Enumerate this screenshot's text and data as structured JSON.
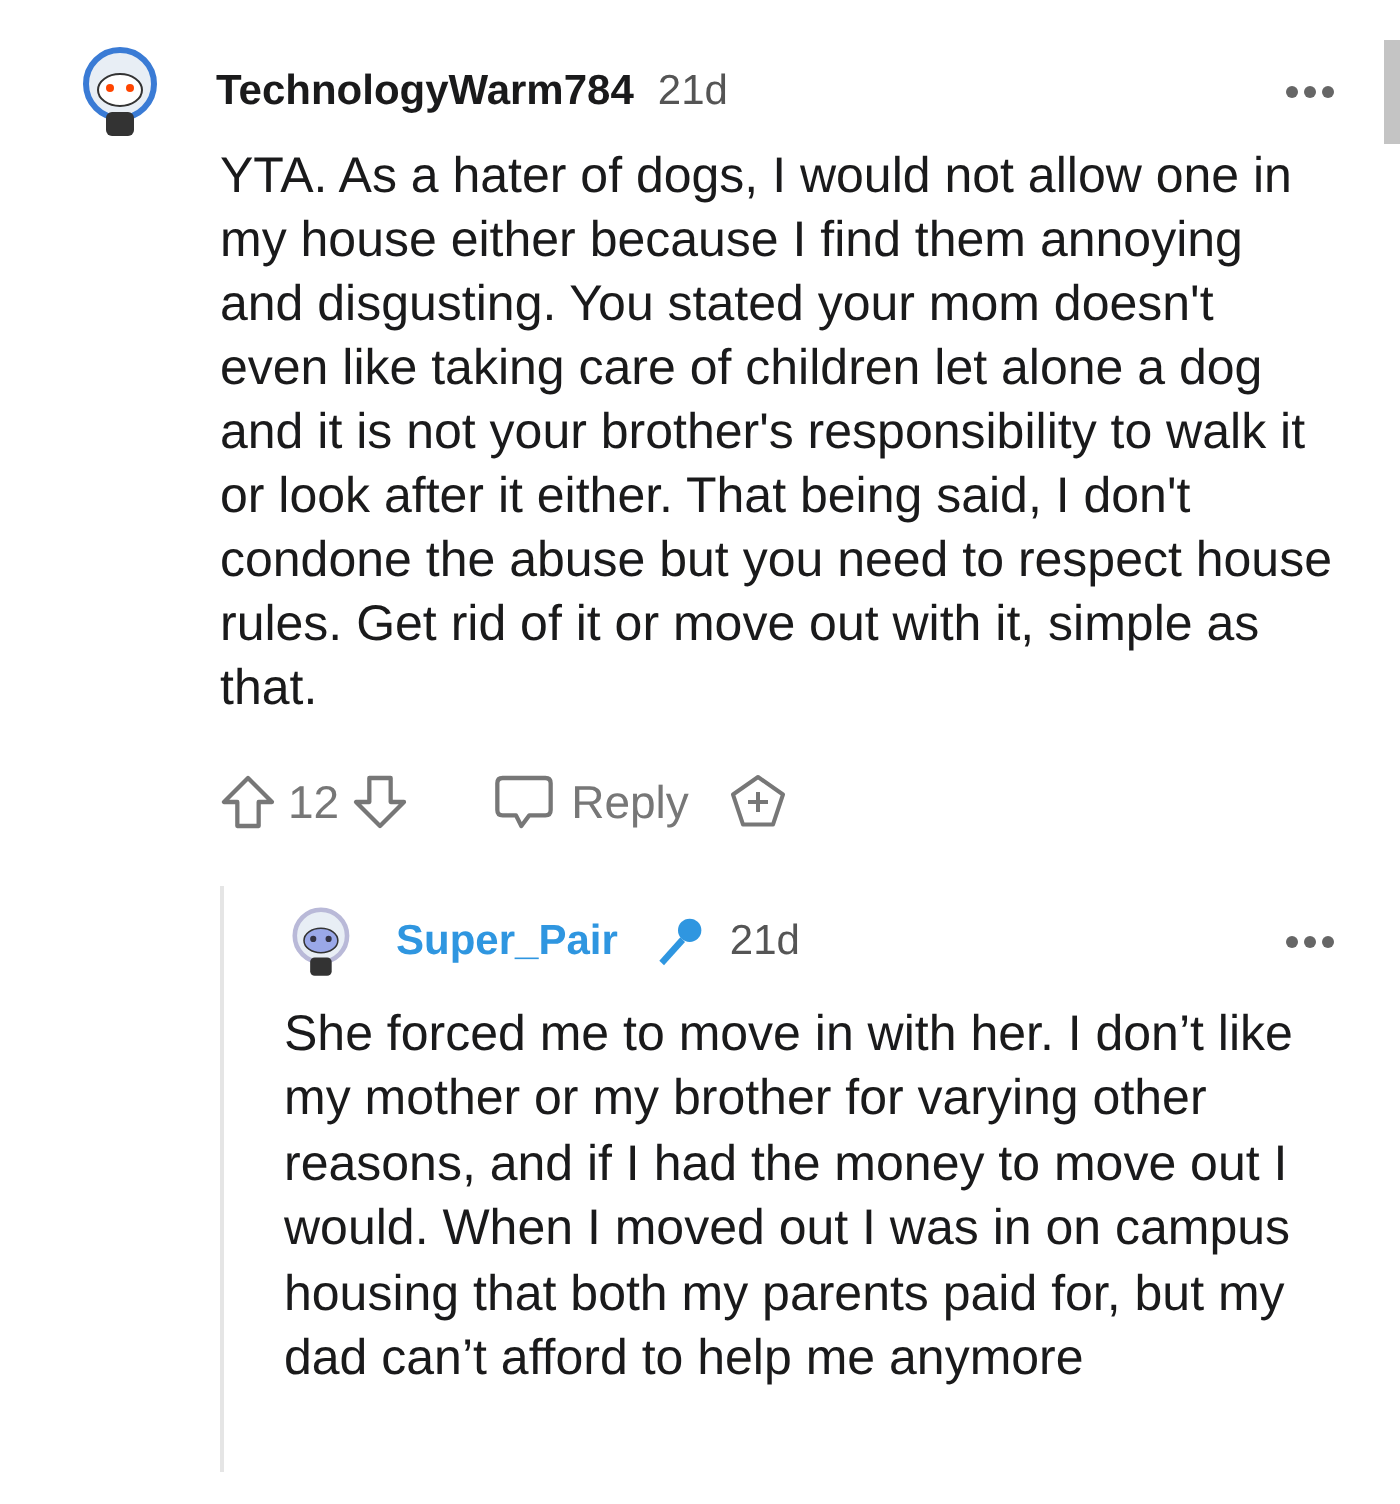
{
  "comment": {
    "username": "TechnologyWarm784",
    "op": false,
    "age": "21d",
    "body": "YTA. As a hater of dogs, I would not allow one in my house either because I find them annoying and disgusting. You stated your mom doesn't even like taking care of children let alone a dog and it is not your brother's responsibility to walk it or look after it either. That being said, I don't condone the abuse but you need to respect house rules. Get rid of it or move out with it, simple as that.",
    "score": "12",
    "reply_label": "Reply"
  },
  "reply": {
    "username": "Super_Pair",
    "op": true,
    "mic": true,
    "age": "21d",
    "body": "She forced me to move in with her. I don’t like my mother or my brother for varying other reasons, and if I had the money to move out I would. When I moved out I was in on campus housing that both my parents paid for, but my dad can’t afford to help me anymore"
  }
}
